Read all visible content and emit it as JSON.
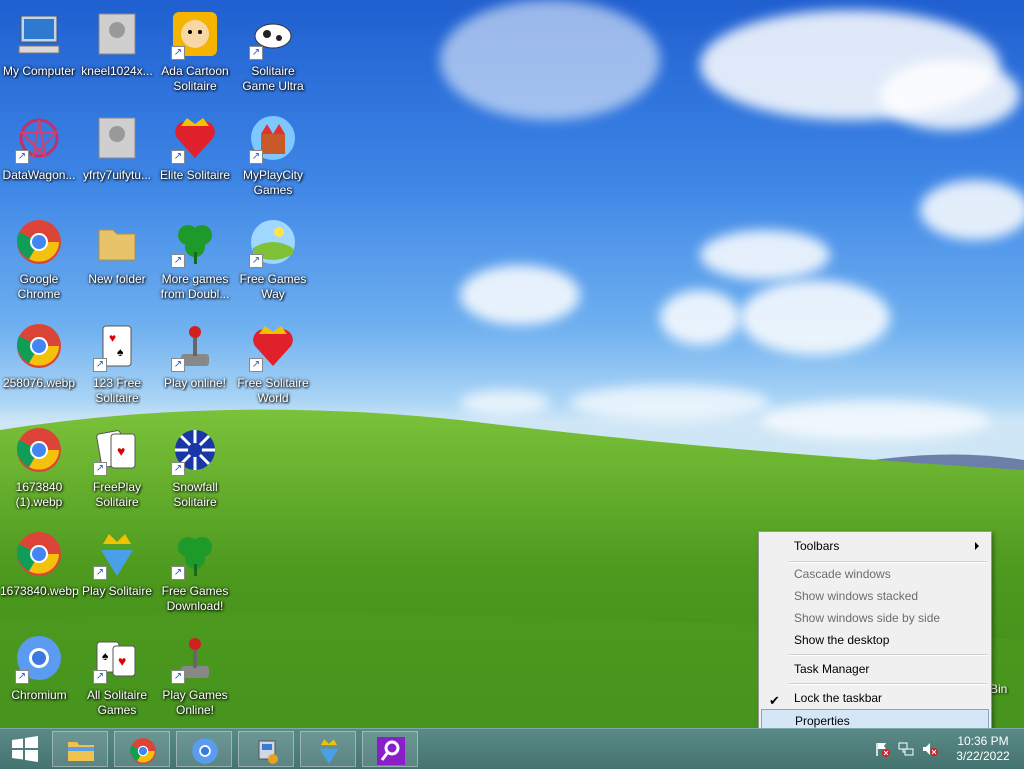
{
  "desktop": {
    "icons": [
      {
        "label": "My Computer"
      },
      {
        "label": "kneel1024x..."
      },
      {
        "label": "Ada Cartoon Solitaire"
      },
      {
        "label": "Solitaire Game Ultra"
      },
      {
        "label": "DataWagon..."
      },
      {
        "label": "yfrty7uifytu..."
      },
      {
        "label": "Elite Solitaire"
      },
      {
        "label": "MyPlayCity Games"
      },
      {
        "label": "Google Chrome"
      },
      {
        "label": "New folder"
      },
      {
        "label": "More games from Doubl..."
      },
      {
        "label": "Free Games Way"
      },
      {
        "label": "258076.webp"
      },
      {
        "label": "123 Free Solitaire"
      },
      {
        "label": "Play online!"
      },
      {
        "label": "Free Solitaire World"
      },
      {
        "label": "1673840 (1).webp"
      },
      {
        "label": "FreePlay Solitaire"
      },
      {
        "label": "Snowfall Solitaire"
      },
      {
        "label": "1673840.webp"
      },
      {
        "label": "Play Solitaire"
      },
      {
        "label": "Free Games Download!"
      },
      {
        "label": "Chromium"
      },
      {
        "label": "All Solitaire Games"
      },
      {
        "label": "Play Games Online!"
      }
    ],
    "partial_bin_label": "Bin"
  },
  "context_menu": {
    "items": [
      {
        "label": "Toolbars"
      },
      {
        "label": "Cascade windows"
      },
      {
        "label": "Show windows stacked"
      },
      {
        "label": "Show windows side by side"
      },
      {
        "label": "Show the desktop"
      },
      {
        "label": "Task Manager"
      },
      {
        "label": "Lock the taskbar",
        "checked": true
      },
      {
        "label": "Properties"
      }
    ]
  },
  "taskbar": {
    "pinned": [
      "file-explorer-icon",
      "chrome-icon",
      "chromium-icon",
      "setup-icon",
      "solitaire-icon",
      "search-app-icon"
    ],
    "clock": {
      "time": "10:36 PM",
      "date": "3/22/2022"
    }
  }
}
